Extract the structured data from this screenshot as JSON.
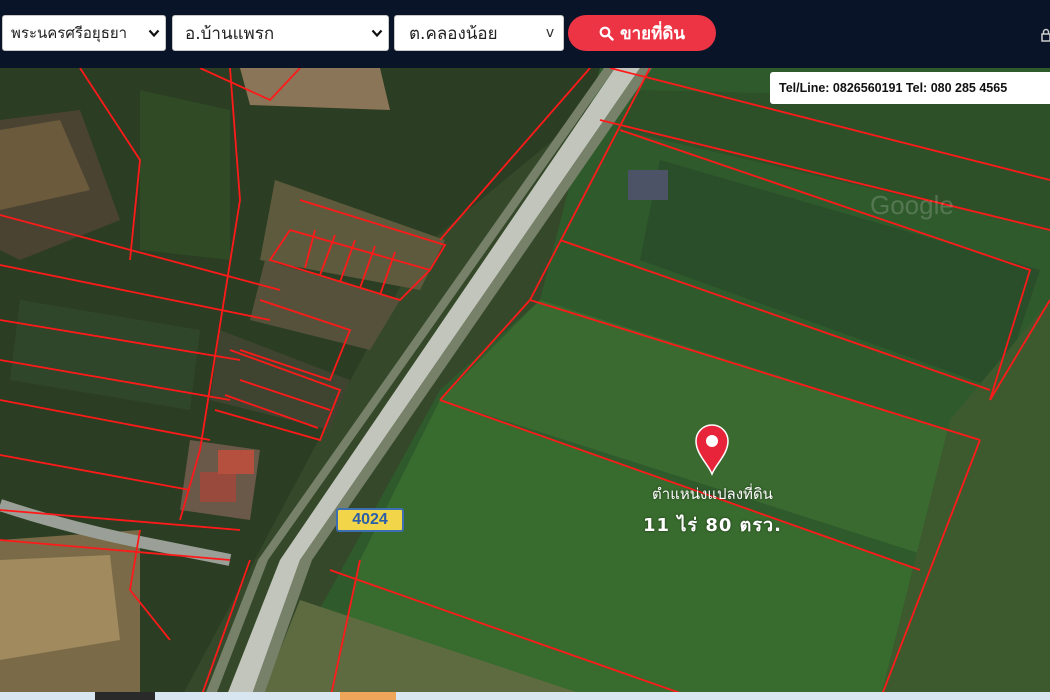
{
  "header": {
    "province": "พระนครศรีอยุธยา",
    "district": "อ.บ้านแพรก",
    "subdistrict": "ต.คลองน้อย",
    "subdistrict_arrow": "v",
    "sale_button_label": "ขายที่ดิน"
  },
  "contact": {
    "text": "Tel/Line: 0826560191  Tel: 080 285 4565"
  },
  "map": {
    "road_number": "4024",
    "plot_label": "ตำแหน่งแปลงที่ดิน",
    "plot_size": "11 ไร่ 80 ตรว.",
    "watermark": "Google",
    "boundary_color": "#ff1a1a",
    "marker_color": "#e8243a"
  },
  "colors": {
    "header_bg": "#091428",
    "button": "#ec3445"
  }
}
